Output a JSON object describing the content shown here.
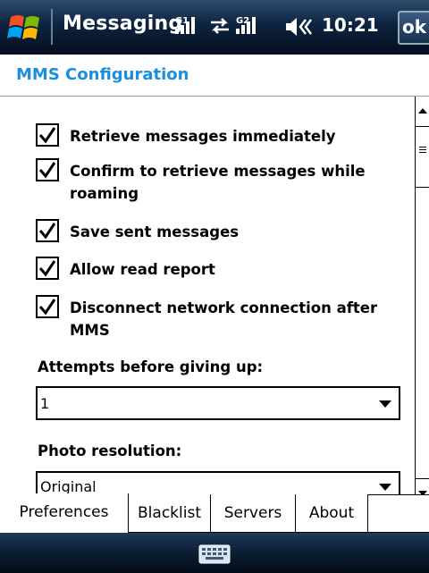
{
  "titlebar": {
    "app_title": "Messaging",
    "time": "10:21",
    "ok_label": "ok",
    "signal1_label": "G1",
    "signal2_label": "G2"
  },
  "header": {
    "title": "MMS Configuration"
  },
  "options": [
    {
      "label": "Retrieve messages immediately",
      "checked": true
    },
    {
      "label": "Confirm to retrieve messages while roaming",
      "checked": true
    },
    {
      "label": "Save sent messages",
      "checked": true
    },
    {
      "label": "Allow read report",
      "checked": true
    },
    {
      "label": "Disconnect network connection after MMS",
      "checked": true
    }
  ],
  "attempts": {
    "label": "Attempts before giving up:",
    "value": "1"
  },
  "photo": {
    "label": "Photo resolution:",
    "value": "Original"
  },
  "tabs": [
    {
      "label": "Preferences",
      "active": true
    },
    {
      "label": "Blacklist",
      "active": false
    },
    {
      "label": "Servers",
      "active": false
    },
    {
      "label": "About",
      "active": false
    }
  ],
  "colors": {
    "accent": "#1a8fe0",
    "titlebar": "#0d2440"
  }
}
